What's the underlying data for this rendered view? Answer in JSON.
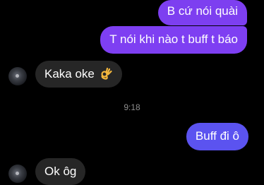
{
  "messages": {
    "out_1": "B cứ nói quài",
    "out_2": "T nói khi nào t buff t báo",
    "in_1": "Kaka oke",
    "in_1_emoji": "ok-hand-emoji",
    "timestamp": "9:18",
    "out_3": "Buff đi ô",
    "in_2": "Ok ôg"
  },
  "colors": {
    "background": "#000000",
    "outgoing_bubble": "#7d3ff0",
    "outgoing_bubble_alt": "#5b53f0",
    "incoming_bubble": "#262626",
    "timestamp_text": "#8e8e8e"
  }
}
